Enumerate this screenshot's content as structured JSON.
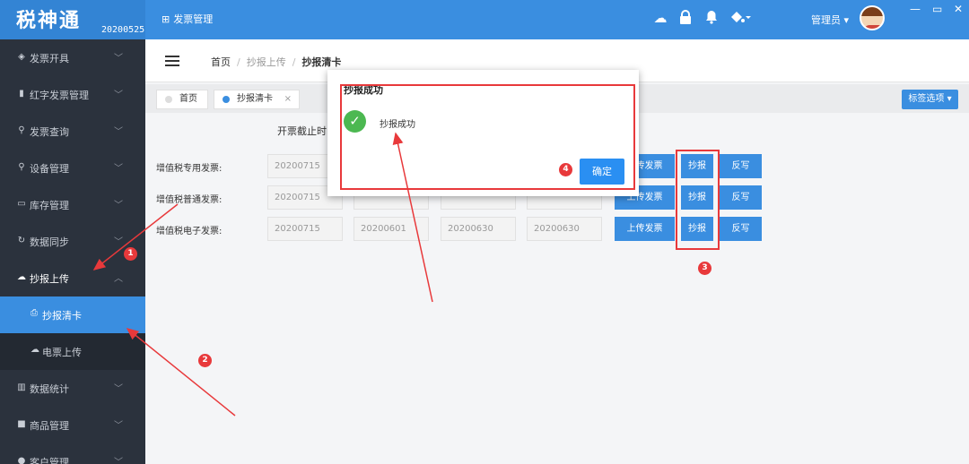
{
  "app": {
    "name": "税神通",
    "version": "20200525",
    "module": "发票管理",
    "module_icon": "grid-icon"
  },
  "topbar": {
    "icons": [
      "cloud-icon",
      "lock-icon",
      "bell-icon",
      "paint-bucket-icon"
    ],
    "user": "管理员",
    "window_controls": [
      "minimize-icon",
      "maximize-icon",
      "close-icon"
    ]
  },
  "sidebar": {
    "items": [
      {
        "label": "发票开具",
        "icon": "cube-icon"
      },
      {
        "label": "红字发票管理",
        "icon": "trash-icon"
      },
      {
        "label": "发票查询",
        "icon": "search-icon"
      },
      {
        "label": "设备管理",
        "icon": "search-icon"
      },
      {
        "label": "库存管理",
        "icon": "folder-icon"
      },
      {
        "label": "数据同步",
        "icon": "sync-icon"
      },
      {
        "label": "抄报上传",
        "icon": "cloud-upload-icon",
        "expanded": true
      },
      {
        "label": "数据统计",
        "icon": "bar-chart-icon"
      },
      {
        "label": "商品管理",
        "icon": "box-icon"
      },
      {
        "label": "客户管理",
        "icon": "user-icon"
      }
    ],
    "subitems": [
      {
        "label": "抄报清卡",
        "active": true,
        "icon": "upload-icon"
      },
      {
        "label": "电票上传",
        "active": false,
        "icon": "cloud-icon"
      }
    ]
  },
  "breadcrumb": {
    "home": "首页",
    "parent": "抄报上传",
    "current": "抄报清卡"
  },
  "tabs": [
    {
      "label": "首页",
      "active": false
    },
    {
      "label": "抄报清卡",
      "active": true,
      "closable": true
    }
  ],
  "tag_options": "标签选项",
  "table": {
    "column_header": "开票截止时间",
    "rows": [
      {
        "label": "增值税专用发票:",
        "v1": "20200715",
        "v2": "",
        "v3": "",
        "v4": ""
      },
      {
        "label": "增值税普通发票:",
        "v1": "20200715",
        "v2": "",
        "v3": "",
        "v4": ""
      },
      {
        "label": "增值税电子发票:",
        "v1": "20200715",
        "v2": "20200601",
        "v3": "20200630",
        "v4": "20200630"
      }
    ],
    "buttons": {
      "upload": "上传发票",
      "report": "抄报",
      "writeback": "反写"
    }
  },
  "modal": {
    "title": "抄报成功",
    "message": "抄报成功",
    "ok": "确定"
  },
  "annotations": [
    "1",
    "2",
    "3",
    "4"
  ],
  "colors": {
    "primary": "#3a8ee0",
    "sidebar": "#2b323d",
    "annotation": "#e8393b",
    "success": "#4cb851"
  }
}
